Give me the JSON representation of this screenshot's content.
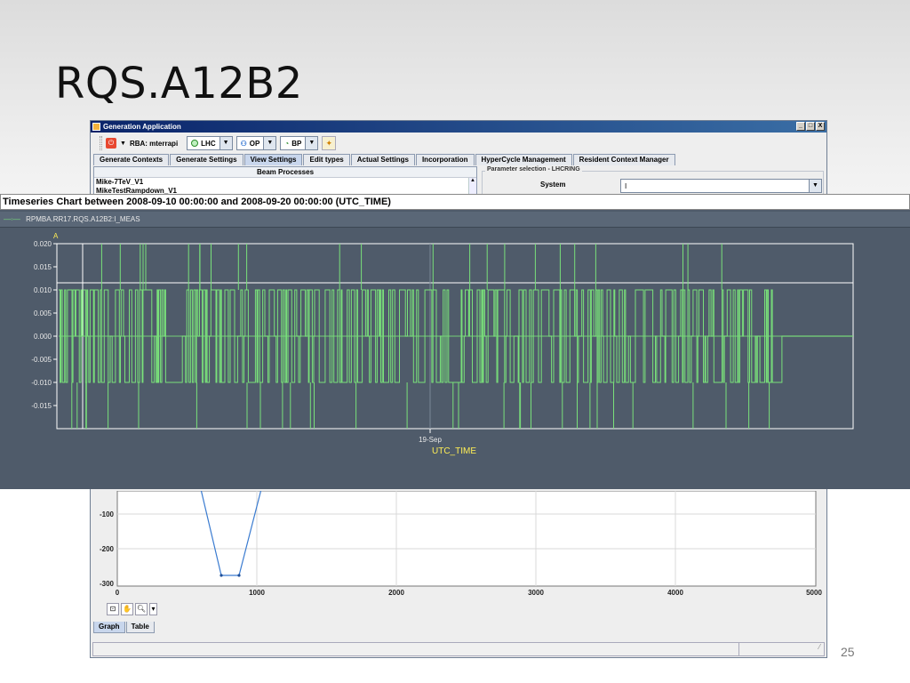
{
  "slide": {
    "title": "RQS.A12B2",
    "page_number": "25"
  },
  "app": {
    "window_title": "Generation Application",
    "window_controls": [
      "_",
      "□",
      "X"
    ],
    "toolbar": {
      "rba_label": "RBA: mterrapi",
      "combos": [
        {
          "name": "accelerator",
          "value": "LHC"
        },
        {
          "name": "mode",
          "value": "OP"
        },
        {
          "name": "beam",
          "value": "BP"
        }
      ]
    },
    "tabs": [
      {
        "label": "Generate Contexts",
        "active": false
      },
      {
        "label": "Generate Settings",
        "active": false
      },
      {
        "label": "View Settings",
        "active": true
      },
      {
        "label": "Edit types",
        "active": false
      },
      {
        "label": "Actual Settings",
        "active": false
      },
      {
        "label": "Incorporation",
        "active": false
      },
      {
        "label": "HyperCycle Management",
        "active": false
      },
      {
        "label": "Resident Context Manager",
        "active": false
      }
    ],
    "beam_processes": {
      "header": "Beam Processes",
      "items": [
        "Mike-7TeV_V1",
        "MikeTestRampdown_V1"
      ]
    },
    "parameter_selection": {
      "legend": "Parameter selection - LHCRING",
      "system_label": "System",
      "system_value": "I"
    },
    "lower_chart": {
      "y_ticks": [
        "-100",
        "-200",
        "-300"
      ],
      "x_ticks": [
        "0",
        "1000",
        "2000",
        "3000",
        "4000",
        "5000"
      ]
    },
    "bottom_tabs": [
      {
        "label": "Graph",
        "active": true
      },
      {
        "label": "Table",
        "active": false
      }
    ]
  },
  "timeseries": {
    "header": "Timeseries Chart between 2008-09-10 00:00:00 and 2008-09-20 00:00:00 (UTC_TIME)",
    "legend_entry": "RPMBA.RR17.RQS.A12B2:I_MEAS",
    "series_color": "#79e07a",
    "chart_data": {
      "type": "line",
      "title": "",
      "ylabel": "A",
      "xlabel": "UTC_TIME",
      "ylim": [
        -0.02,
        0.02
      ],
      "y_ticks": [
        "0.020",
        "0.015",
        "0.010",
        "0.005",
        "0.000",
        "-0.005",
        "-0.010",
        "-0.015"
      ],
      "x_tick_label": "19-Sep",
      "series": [
        {
          "name": "RPMBA.RR17.RQS.A12B2:I_MEAS",
          "approx_levels": [
            -0.01,
            0.0,
            0.01
          ],
          "spike_levels": [
            -0.02,
            0.02
          ],
          "flat_after_fraction": 0.91
        }
      ]
    }
  }
}
